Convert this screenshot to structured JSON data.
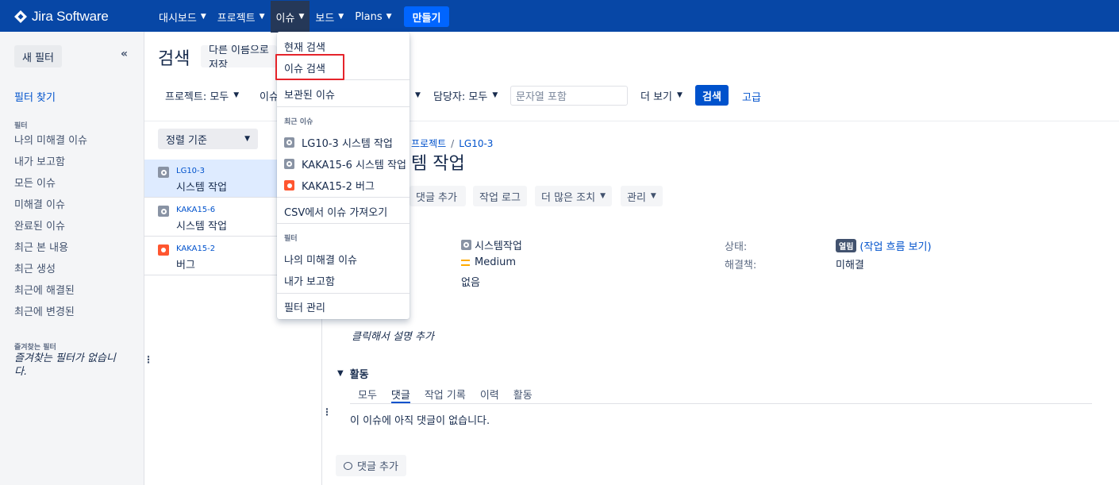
{
  "nav": {
    "logo": "Jira Software",
    "items": [
      {
        "label": "대시보드"
      },
      {
        "label": "프로젝트"
      },
      {
        "label": "이슈"
      },
      {
        "label": "보드"
      },
      {
        "label": "Plans"
      }
    ],
    "create": "만들기"
  },
  "sidebar": {
    "new_filter": "새 필터",
    "collapse": "«",
    "find_filters": "필터 찾기",
    "filters_heading": "필터",
    "filters": [
      "나의 미해결 이슈",
      "내가 보고함",
      "모든 이슈",
      "미해결 이슈",
      "완료된 이슈",
      "최근 본 내용",
      "최근 생성",
      "최근에 해결된",
      "최근에 변경된"
    ],
    "favorites_heading": "즐겨찾는 필터",
    "favorites_empty": "즐겨찾는 필터가 없습니다."
  },
  "header": {
    "title": "검색",
    "save_as": "다른 이름으로 저장"
  },
  "filter_bar": {
    "project": "프로젝트: 모두",
    "type": "이슈",
    "assignee": "담당자: 모두",
    "text_placeholder": "문자열 포함",
    "more": "더 보기",
    "search": "검색",
    "advanced": "고급"
  },
  "list": {
    "sort": "정렬 기준",
    "issues": [
      {
        "key": "LG10-3",
        "summary": "시스템 작업",
        "type": "task"
      },
      {
        "key": "KAKA15-6",
        "summary": "시스템 작업",
        "type": "task"
      },
      {
        "key": "KAKA15-2",
        "summary": "버그",
        "type": "bug"
      }
    ]
  },
  "detail": {
    "breadcrumb_project": "프로젝트",
    "breadcrumb_sep": "/",
    "breadcrumb_key": "LG10-3",
    "title": "템 작업",
    "actions": {
      "comment": "댓글 추가",
      "log_work": "작업 로그",
      "more_actions": "더 많은 조치",
      "admin": "관리"
    },
    "fields": {
      "type_value": "시스템작업",
      "priority_value": "Medium",
      "labels_value": "없음",
      "status_label": "상태:",
      "status_value": "열림",
      "workflow_link": "(작업 흐름 보기)",
      "resolution_label": "해결책:",
      "resolution_value": "미해결"
    },
    "description_placeholder": "클릭해서 설명 추가",
    "activity_heading": "활동",
    "tabs": [
      "모두",
      "댓글",
      "작업 기록",
      "이력",
      "활동"
    ],
    "no_comments": "이 이슈에 아직 댓글이 없습니다.",
    "add_comment": "댓글 추가"
  },
  "dropdown": {
    "current_search": "현재 검색",
    "search_issues": "이슈 검색",
    "archived": "보관된 이슈",
    "recent_heading": "최근 이슈",
    "recent": [
      {
        "label": "LG10-3 시스템 작업",
        "type": "task"
      },
      {
        "label": "KAKA15-6 시스템 작업",
        "type": "task"
      },
      {
        "label": "KAKA15-2 버그",
        "type": "bug"
      }
    ],
    "import_csv": "CSV에서 이슈 가져오기",
    "filters_heading": "필터",
    "filters": [
      "나의 미해결 이슈",
      "내가 보고함"
    ],
    "manage_filters": "필터 관리"
  }
}
